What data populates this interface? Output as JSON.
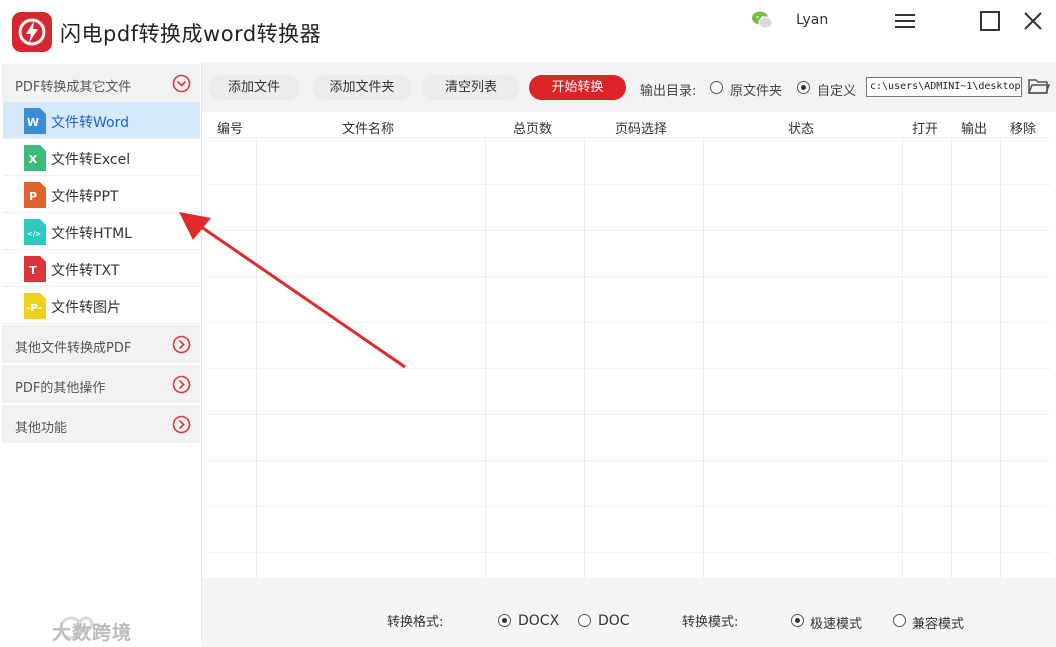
{
  "app": {
    "title": "闪电pdf转换成word转换器",
    "username": "Lyan",
    "accent": "#dc2328"
  },
  "sidebar": {
    "groups": [
      {
        "label": "PDF转换成其它文件",
        "expanded": true
      },
      {
        "label": "其他文件转换成PDF",
        "expanded": false
      },
      {
        "label": "PDF的其他操作",
        "expanded": false
      },
      {
        "label": "其他功能",
        "expanded": false
      }
    ],
    "items": [
      {
        "label": "文件转Word",
        "icon": "word-file-icon",
        "icon_letter": "W",
        "color": "#3b8ed6",
        "active": true
      },
      {
        "label": "文件转Excel",
        "icon": "excel-file-icon",
        "icon_letter": "X",
        "color": "#3dbb7d",
        "active": false
      },
      {
        "label": "文件转PPT",
        "icon": "ppt-file-icon",
        "icon_letter": "P",
        "color": "#e0632c",
        "active": false
      },
      {
        "label": "文件转HTML",
        "icon": "html-file-icon",
        "icon_letter": "</>",
        "color": "#2cc9c0",
        "active": false
      },
      {
        "label": "文件转TXT",
        "icon": "txt-file-icon",
        "icon_letter": "T",
        "color": "#d9363a",
        "active": false
      },
      {
        "label": "文件转图片",
        "icon": "image-file-icon",
        "icon_letter": "P",
        "color": "#f0d01e",
        "active": false
      }
    ]
  },
  "toolbar": {
    "add_file": "添加文件",
    "add_folder": "添加文件夹",
    "clear_list": "清空列表",
    "start_convert": "开始转换",
    "output_dir_label": "输出目录:",
    "output_original": "原文件夹",
    "output_custom": "自定义",
    "output_selected": "custom",
    "output_path": "c:\\users\\ADMINI~1\\desktop"
  },
  "table": {
    "columns": [
      "编号",
      "文件名称",
      "总页数",
      "页码选择",
      "状态",
      "打开",
      "输出",
      "移除"
    ],
    "rows": []
  },
  "bottom": {
    "format_label": "转换格式:",
    "format_options": [
      "DOCX",
      "DOC"
    ],
    "format_selected": "DOCX",
    "mode_label": "转换模式:",
    "mode_options": [
      "极速模式",
      "兼容模式"
    ],
    "mode_selected": "极速模式"
  },
  "watermark": {
    "text": "大数跨境"
  }
}
